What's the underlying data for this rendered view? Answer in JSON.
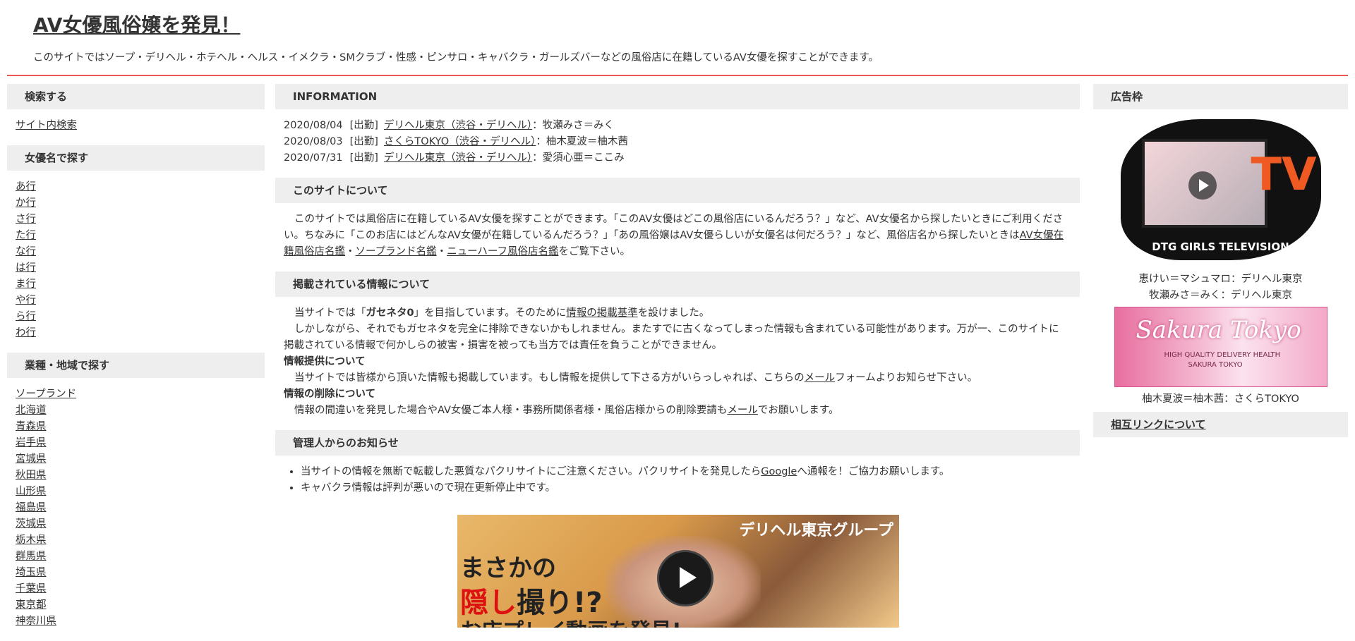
{
  "header": {
    "title": "AV女優風俗嬢を発見！",
    "description": "このサイトではソープ・デリヘル・ホテヘル・ヘルス・イメクラ・SMクラブ・性感・ピンサロ・キャバクラ・ガールズバーなどの風俗店に在籍しているAV女優を探すことができます。"
  },
  "left": {
    "search_head": "検索する",
    "search_link": "サイト内検索",
    "actress_head": "女優名で探す",
    "actress_items": [
      "あ行",
      "か行",
      "さ行",
      "た行",
      "な行",
      "は行",
      "ま行",
      "や行",
      "ら行",
      "わ行"
    ],
    "area_head": "業種・地域で探す",
    "area_items": [
      "ソープランド",
      "北海道",
      "青森県",
      "岩手県",
      "宮城県",
      "秋田県",
      "山形県",
      "福島県",
      "茨城県",
      "栃木県",
      "群馬県",
      "埼玉県",
      "千葉県",
      "東京都",
      "神奈川県"
    ]
  },
  "main": {
    "info_head": "INFORMATION",
    "info": [
      {
        "date": "2020/08/04",
        "tag": "[出勤]",
        "shop": "デリヘル東京（渋谷・デリヘル）",
        "name": "：牧瀬みさ＝みく"
      },
      {
        "date": "2020/08/03",
        "tag": "[出勤]",
        "shop": "さくらTOKYO（渋谷・デリヘル）",
        "name": "：柚木夏波＝柚木茜"
      },
      {
        "date": "2020/07/31",
        "tag": "[出勤]",
        "shop": "デリヘル東京（渋谷・デリヘル）",
        "name": "：愛須心亜＝ここみ"
      }
    ],
    "about_head": "このサイトについて",
    "about": {
      "t1": "このサイトでは風俗店に在籍しているAV女優を探すことができます。「このAV女優はどこの風俗店にいるんだろう？」など、AV女優名から探したいときにご利用ください。ちなみに「このお店にはどんなAV女優が在籍しているんだろう？」「あの風俗嬢はAV女優らしいが女優名は何だろう？」など、風俗店名から探したいときは",
      "link1": "AV女優在籍風俗店名鑑",
      "sep1": "・",
      "link2": "ソープランド名鑑",
      "sep2": "・",
      "link3": "ニューハーフ風俗店名鑑",
      "t2": "をご覧下さい。"
    },
    "posted_head": "掲載されている情報について",
    "posted": {
      "p1a": "当サイトでは「",
      "p1b": "ガセネタ0",
      "p1c": "」を目指しています。そのために",
      "p1link": "情報の掲載基準",
      "p1d": "を設けました。",
      "p2": "しかしながら、それでもガセネタを完全に排除できないかもしれません。またすでに古くなってしまった情報も含まれている可能性があります。万が一、このサイトに掲載されている情報で何かしらの被害・損害を被っても当方では責任を負うことができません。",
      "h_provide": "情報提供について",
      "p3a": "当サイトでは皆様から頂いた情報も掲載しています。もし情報を提供して下さる方がいらっしゃれば、こちらの",
      "p3link": "メール",
      "p3b": "フォームよりお知らせ下さい。",
      "h_delete": "情報の削除について",
      "p4a": "情報の間違いを発見した場合やAV女優ご本人様・事務所関係者様・風俗店様からの削除要請も",
      "p4link": "メール",
      "p4b": "でお願いします。"
    },
    "notice_head": "管理人からのお知らせ",
    "notice": {
      "n1a": "当サイトの情報を無断で転載した悪質なパクリサイトにご注意ください。パクリサイトを発見したら",
      "n1link": "Google",
      "n1b": "へ通報を！ご協力お願いします。",
      "n2": "キャバクラ情報は評判が悪いので現在更新停止中です。"
    },
    "banner": {
      "head": "デリヘル東京グループ",
      "line1": "まさかの",
      "line2a": "隠し",
      "line2b": "撮",
      "line2c": "り!?",
      "line3": "お店プレイ動画を発見!"
    }
  },
  "right": {
    "ad_head": "広告枠",
    "tv_logo": "TV",
    "tv_caption": "DTG GIRLS TELEVISION",
    "ad1_line1": "恵けい＝マシュマロ：デリヘル東京",
    "ad1_line2": "牧瀬みさ＝みく：デリヘル東京",
    "sakura_title": "Sakura Tokyo",
    "sakura_sub": "HIGH QUALITY DELIVERY HEALTH",
    "sakura_sub2": "SAKURA TOKYO",
    "ad2_caption": "柚木夏波＝柚木茜：さくらTOKYO",
    "mutual_link": "相互リンクについて"
  },
  "colors": {
    "accent_line": "#ee5555",
    "section_bg": "#eeeeee",
    "text": "#333333"
  }
}
